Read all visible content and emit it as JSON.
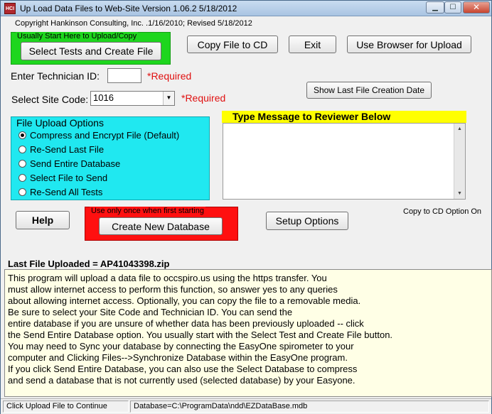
{
  "window": {
    "icon_text": "HCI",
    "title": "Up Load Data Files to Web-Site Version 1.06.2   5/18/2012",
    "controls": {
      "minimize": "▁",
      "maximize": "☐",
      "close": "✕"
    }
  },
  "copyright": "Copyright Hankinson Consulting, Inc.  .1/16/2010; Revised 5/18/2012",
  "start_box": {
    "label": "Usually Start Here to Upload/Copy",
    "button": "Select Tests and Create File"
  },
  "toolbar": {
    "copy_cd": "Copy File to CD",
    "exit": "Exit",
    "browser_upload": "Use Browser for Upload"
  },
  "technician": {
    "label": "Enter Technician ID:",
    "value": "",
    "required": "*Required"
  },
  "site": {
    "label": "Select Site Code:",
    "value": "1016",
    "required": "*Required"
  },
  "show_date_button": "Show Last File Creation Date",
  "upload_options": {
    "title": "File Upload Options",
    "options": [
      {
        "label": "Compress and Encrypt File (Default)",
        "selected": true
      },
      {
        "label": "Re-Send Last File",
        "selected": false
      },
      {
        "label": "Send Entire Database",
        "selected": false
      },
      {
        "label": "Select File to Send",
        "selected": false
      },
      {
        "label": "Re-Send All Tests",
        "selected": false
      }
    ]
  },
  "message": {
    "title": "Type Message to Reviewer Below",
    "value": ""
  },
  "help_button": "Help",
  "new_db": {
    "label": "Use only once when first starting",
    "button": "Create New Database"
  },
  "setup_button": "Setup Options",
  "copy_cd_status": "Copy to CD Option On",
  "last_file": "Last File Uploaded = AP41043398.zip",
  "info_lines": [
    "This program will upload a data file to occspiro.us using the https transfer.  You",
    "must allow internet access to perform this function, so answer yes to any queries",
    "about allowing internet access.  Optionally, you can  copy the file to a removable media.",
    "  Be sure to select your Site Code and Technician ID.  You can send the",
    "entire database if you are unsure of whether data has been previously uploaded -- click",
    "the Send Entire Database option.  You usually start with the Select Test and Create File button.",
    "  You may need to Sync your database by connecting the EasyOne spirometer to your",
    "computer and Clicking Files-->Synchronize Database within the EasyOne program.",
    "  If you click Send Entire Database, you can also use the Select Database to compress",
    "and send a database that is not currently used (selected database) by your Easyone."
  ],
  "status": {
    "left": "Click Upload File to Continue",
    "right": "Database=C:\\ProgramData\\ndd\\EZDataBase.mdb"
  }
}
